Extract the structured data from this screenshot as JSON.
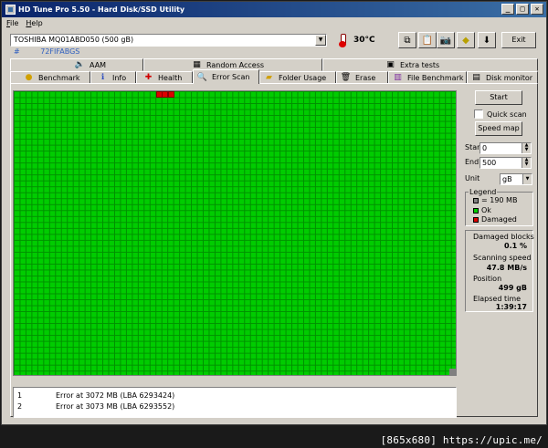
{
  "window": {
    "title": "HD Tune Pro 5.50 - Hard Disk/SSD Utility",
    "minimize": "_",
    "maximize": "□",
    "close": "✕"
  },
  "menu": {
    "file": "File",
    "help": "Help"
  },
  "drive": {
    "selected": "TOSHIBA MQ01ABD050 (500 gB)",
    "hash": "#",
    "serial": "72FIFABGS"
  },
  "temperature": {
    "value": "30",
    "unit": "°C"
  },
  "toolbar": {
    "icons": [
      "copy-icon",
      "paste-icon",
      "camera-icon",
      "tag-icon",
      "download-icon"
    ],
    "exit_label": "Exit"
  },
  "tabs_top": [
    {
      "label": "AAM",
      "icon": "speaker-icon"
    },
    {
      "label": "Random Access",
      "icon": "random-access-icon"
    },
    {
      "label": "Extra tests",
      "icon": "extra-tests-icon"
    }
  ],
  "tabs_bottom": [
    {
      "label": "Benchmark",
      "icon": "benchmark-icon"
    },
    {
      "label": "Info",
      "icon": "info-icon"
    },
    {
      "label": "Health",
      "icon": "health-icon"
    },
    {
      "label": "Error Scan",
      "icon": "magnifier-icon",
      "active": true
    },
    {
      "label": "Folder Usage",
      "icon": "folder-icon"
    },
    {
      "label": "Erase",
      "icon": "trash-icon"
    },
    {
      "label": "File Benchmark",
      "icon": "file-benchmark-icon"
    },
    {
      "label": "Disk monitor",
      "icon": "disk-monitor-icon"
    }
  ],
  "controls": {
    "start_label": "Start",
    "quick_scan_label": "Quick scan",
    "quick_scan_checked": false,
    "speed_map_label": "Speed map",
    "start_field_label": "Start",
    "start_value": "0",
    "end_field_label": "End",
    "end_value": "500",
    "unit_label": "Unit",
    "unit_value": "gB"
  },
  "legend": {
    "title": "Legend",
    "items": [
      {
        "label": "= 190 MB",
        "color": "#808080"
      },
      {
        "label": "Ok",
        "color": "#00cc00"
      },
      {
        "label": "Damaged",
        "color": "#dd0000"
      }
    ]
  },
  "stats": {
    "damaged_blocks_label": "Damaged blocks",
    "damaged_blocks_value": "0.1 %",
    "scanning_speed_label": "Scanning speed",
    "scanning_speed_value": "47.8 MB/s",
    "position_label": "Position",
    "position_value": "499 gB",
    "elapsed_label": "Elapsed time",
    "elapsed_value": "1:39:17"
  },
  "scan_map": {
    "ok_color": "#00cc00",
    "damaged_color": "#dd0000",
    "damaged_block_count": 3
  },
  "log": [
    {
      "n": "1",
      "text": "Error at 3072 MB (LBA 6293424)"
    },
    {
      "n": "2",
      "text": "Error at 3073 MB (LBA 6293552)"
    }
  ],
  "watermark": "[865x680] https://upic.me/"
}
